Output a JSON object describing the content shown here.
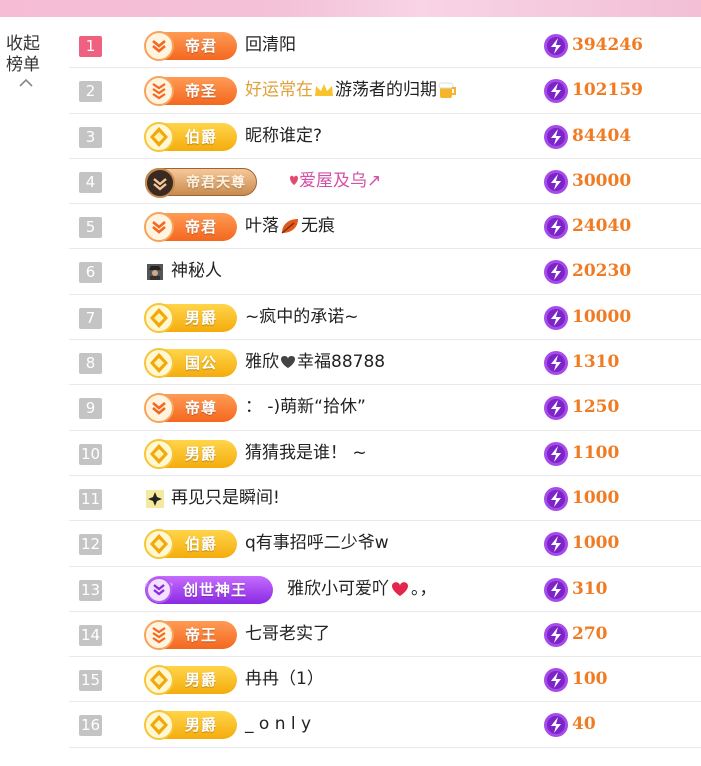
{
  "collapse": {
    "label": "收起榜单"
  },
  "rows": [
    {
      "rank": "1",
      "tier": "帝君",
      "nick": "回清阳",
      "score": "394246"
    },
    {
      "rank": "2",
      "tier": "帝圣",
      "nick": "好运常在",
      "nick2": "游荡者的归期",
      "score": "102159"
    },
    {
      "rank": "3",
      "tier": "伯爵",
      "nick": "昵称谁定?",
      "score": "84404"
    },
    {
      "rank": "4",
      "tier": "帝君天尊",
      "nick": "爱屋及乌↗",
      "score": "30000"
    },
    {
      "rank": "5",
      "tier": "帝君",
      "nick": "叶落",
      "nick2": "无痕",
      "score": "24040"
    },
    {
      "rank": "6",
      "nick": "神秘人",
      "score": "20230"
    },
    {
      "rank": "7",
      "tier": "男爵",
      "nick": "~疯中的承诺~",
      "score": "10000"
    },
    {
      "rank": "8",
      "tier": "国公",
      "nick": "雅欣",
      "nick2": "幸福88788",
      "score": "1310"
    },
    {
      "rank": "9",
      "tier": "帝尊",
      "nick": "： -)萌新“拾休”",
      "score": "1250"
    },
    {
      "rank": "10",
      "tier": "男爵",
      "nick": "猜猜我是谁！ ~",
      "score": "1100"
    },
    {
      "rank": "11",
      "nick": "再见只是瞬间!",
      "score": "1000"
    },
    {
      "rank": "12",
      "tier": "伯爵",
      "nick": "q有事招呼二少爷w",
      "score": "1000"
    },
    {
      "rank": "13",
      "tier": "创世神王",
      "nick": "雅欣小可爱吖",
      "nick2": "。，",
      "score": "310"
    },
    {
      "rank": "14",
      "tier": "帝王",
      "nick": "七哥老实了",
      "score": "270"
    },
    {
      "rank": "15",
      "tier": "男爵",
      "nick": "冉冉（1）",
      "score": "100"
    },
    {
      "rank": "16",
      "tier": "男爵",
      "nick": "_ o n l y",
      "score": "40"
    }
  ],
  "colors": {
    "rank_top": "#f0607f",
    "rank_default": "#c4c4c4",
    "score": "#f07b23",
    "badge_orange": "#f4671f",
    "badge_gold": "#f4ac0c",
    "badge_purple": "#8a2ae3"
  },
  "icons": {
    "score": "lightning-coin-icon",
    "collapse": "chevron-up-icon",
    "tier": "rank-emblem-icon"
  }
}
